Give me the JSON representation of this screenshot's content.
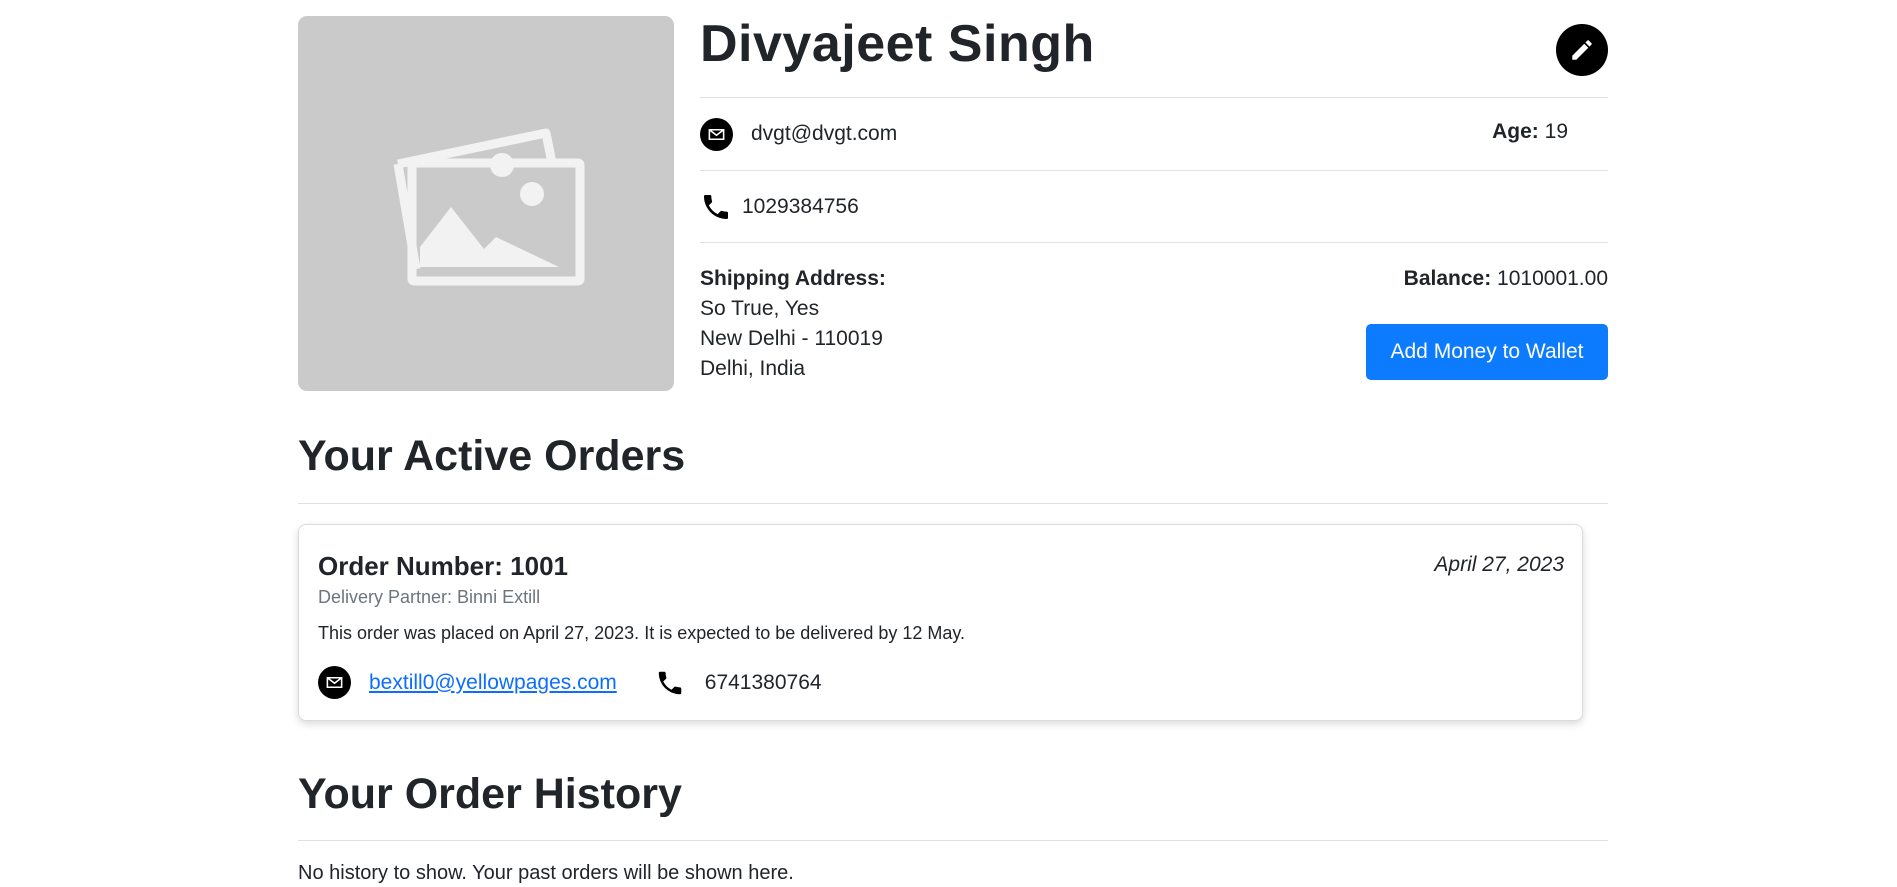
{
  "profile": {
    "name": "Divyajeet Singh",
    "email": "dvgt@dvgt.com",
    "age_label": "Age:",
    "age_value": "19",
    "phone": "1029384756",
    "shipping_label": "Shipping Address:",
    "address_lines": [
      "So True, Yes",
      "New Delhi - 110019",
      "Delhi, India"
    ],
    "balance_label": "Balance:",
    "balance_value": "1010001.00",
    "wallet_button": "Add Money to Wallet",
    "icons": {
      "avatar": "image-placeholder-icon",
      "edit": "pencil-icon",
      "email": "envelope-icon",
      "phone": "phone-icon"
    }
  },
  "active_orders": {
    "title": "Your Active Orders",
    "orders": [
      {
        "title": "Order Number: 1001",
        "date": "April 27, 2023",
        "partner": "Delivery Partner: Binni Extill",
        "description": "This order was placed on April 27, 2023. It is expected to be delivered by 12 May.",
        "partner_email": "bextill0@yellowpages.com",
        "partner_phone": "6741380764"
      }
    ]
  },
  "order_history": {
    "title": "Your Order History",
    "empty_text": "No history to show. Your past orders will be shown here."
  },
  "colors": {
    "primary_button": "#0d7bfd",
    "link": "#0d6efd",
    "avatar_bg": "#cacaca",
    "text": "#212529",
    "muted": "#6c757d"
  }
}
